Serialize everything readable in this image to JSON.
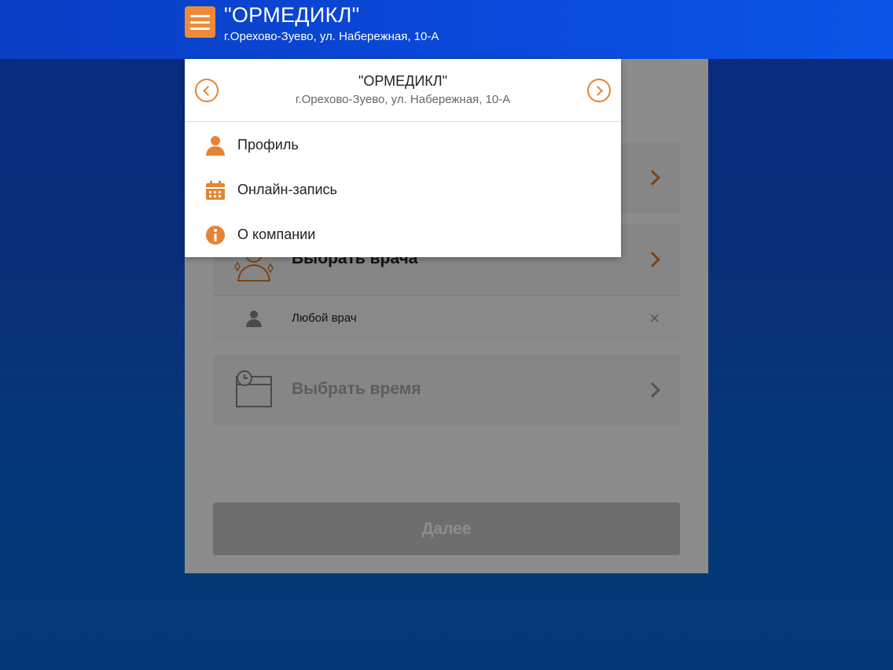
{
  "header": {
    "title": "\"ОРМЕДИКЛ\"",
    "address": "г.Орехово-Зуево, ул. Набережная, 10-А"
  },
  "dropdown": {
    "title": "\"ОРМЕДИКЛ\"",
    "address": "г.Орехово-Зуево, ул. Набережная, 10-А",
    "items": [
      {
        "label": "Профиль",
        "icon": "user-icon"
      },
      {
        "label": "Онлайн-запись",
        "icon": "calendar-icon"
      },
      {
        "label": "О компании",
        "icon": "info-icon"
      }
    ]
  },
  "main": {
    "choose_doctor": "Выбрать врача",
    "any_doctor": "Любой врач",
    "choose_time": "Выбрать время",
    "next_button": "Далее"
  },
  "colors": {
    "accent": "#ee8a3a",
    "header": "#0a48d8"
  }
}
